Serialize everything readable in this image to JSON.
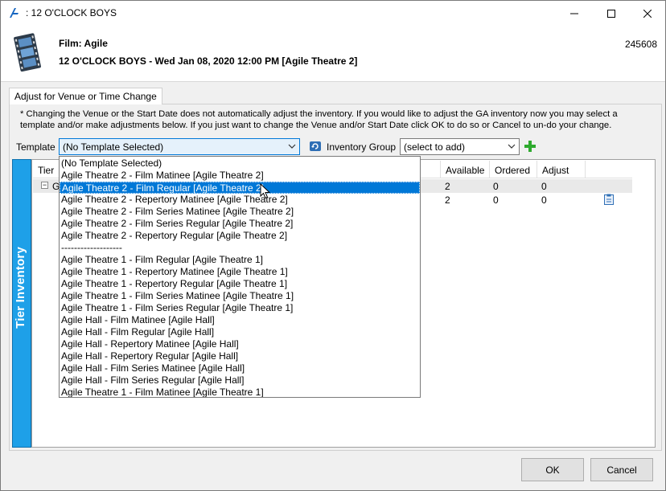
{
  "window": {
    "title": ": 12 O'CLOCK BOYS"
  },
  "header": {
    "film_title": "Film: Agile",
    "performance": "12 O'CLOCK BOYS - Wed Jan 08, 2020 12:00 PM [Agile Theatre 2]",
    "id": "245608"
  },
  "tab": {
    "label": "Adjust for Venue or Time Change"
  },
  "info_text": "* Changing the Venue or the Start Date does not automatically adjust the inventory. If you would like to adjust the GA inventory now you may select a template and/or make adjustments below. If you just want to change the Venue and/or Start Date click OK to do so or Cancel to un-do your change.",
  "template": {
    "label": "Template",
    "value": "(No Template Selected)"
  },
  "inventory_group": {
    "label": "Inventory Group",
    "value": "(select to add)"
  },
  "side_label": "Tier Inventory",
  "grid": {
    "columns": [
      "Tier",
      "Available",
      "Ordered",
      "Adjust"
    ],
    "rows": [
      {
        "tier": "G",
        "available": "2",
        "ordered": "0",
        "adjust": "0"
      },
      {
        "tier": "",
        "available": "2",
        "ordered": "0",
        "adjust": "0"
      }
    ]
  },
  "dropdown": {
    "selected_index": 2,
    "items": [
      "(No Template Selected)",
      "Agile Theatre 2 - Film Matinee [Agile Theatre 2]",
      "Agile Theatre 2 - Film Regular [Agile Theatre 2]",
      "Agile Theatre 2 - Repertory Matinee [Agile Theatre 2]",
      "Agile Theatre 2 - Film Series Matinee [Agile Theatre 2]",
      "Agile Theatre 2 - Film Series Regular [Agile Theatre 2]",
      "Agile Theatre 2 - Repertory Regular [Agile Theatre 2]",
      "-------------------",
      "Agile Theatre 1 - Film Regular [Agile Theatre 1]",
      "Agile Theatre 1 - Repertory Matinee [Agile Theatre 1]",
      "Agile Theatre 1 - Repertory Regular [Agile Theatre 1]",
      "Agile Theatre 1 - Film Series Matinee [Agile Theatre 1]",
      "Agile Theatre 1 - Film Series Regular [Agile Theatre 1]",
      "Agile Hall - Film Matinee [Agile Hall]",
      "Agile Hall - Film Regular [Agile Hall]",
      "Agile Hall - Repertory Matinee [Agile Hall]",
      "Agile Hall - Repertory Regular [Agile Hall]",
      "Agile Hall - Film Series Matinee [Agile Hall]",
      "Agile Hall - Film Series Regular [Agile Hall]",
      "Agile Theatre 1 - Film Matinee [Agile Theatre 1]"
    ]
  },
  "buttons": {
    "ok": "OK",
    "cancel": "Cancel"
  },
  "colors": {
    "accent": "#0078d7",
    "side_band": "#1ea0e8",
    "add_green": "#2eaa2e"
  }
}
